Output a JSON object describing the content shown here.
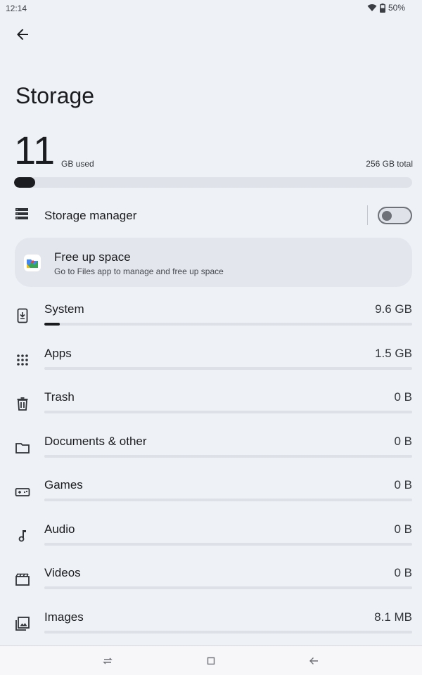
{
  "status_bar": {
    "time": "12:14",
    "battery": "50%",
    "icons": [
      "wifi-icon",
      "battery-icon"
    ]
  },
  "header": {
    "back_icon": "back-arrow-icon",
    "title": "Storage"
  },
  "summary": {
    "used_value": "11",
    "used_unit": "GB used",
    "total": "256 GB total",
    "used_fraction": 0.043
  },
  "storage_manager": {
    "label": "Storage manager",
    "enabled": false,
    "icon": "storage-list-icon"
  },
  "free_up": {
    "title": "Free up space",
    "subtitle": "Go to Files app to manage and free up space",
    "icon": "files-app-icon"
  },
  "categories": [
    {
      "label": "System",
      "size": "9.6 GB",
      "fraction": 0.042,
      "icon": "system-download-icon"
    },
    {
      "label": "Apps",
      "size": "1.5 GB",
      "fraction": 0.0,
      "icon": "apps-grid-icon"
    },
    {
      "label": "Trash",
      "size": "0 B",
      "fraction": 0.0,
      "icon": "trash-icon"
    },
    {
      "label": "Documents & other",
      "size": "0 B",
      "fraction": 0.0,
      "icon": "folder-icon"
    },
    {
      "label": "Games",
      "size": "0 B",
      "fraction": 0.0,
      "icon": "gamepad-icon"
    },
    {
      "label": "Audio",
      "size": "0 B",
      "fraction": 0.0,
      "icon": "music-note-icon"
    },
    {
      "label": "Videos",
      "size": "0 B",
      "fraction": 0.0,
      "icon": "movie-icon"
    },
    {
      "label": "Images",
      "size": "8.1 MB",
      "fraction": 0.0,
      "icon": "image-icon"
    }
  ],
  "nav_bar": {
    "icons": [
      "recents-icon",
      "home-icon",
      "back-icon"
    ]
  },
  "colors": {
    "background": "#eef1f6",
    "accent_dark": "#1b1c1f",
    "track": "#dde0e6",
    "card": "#e3e6ec"
  }
}
